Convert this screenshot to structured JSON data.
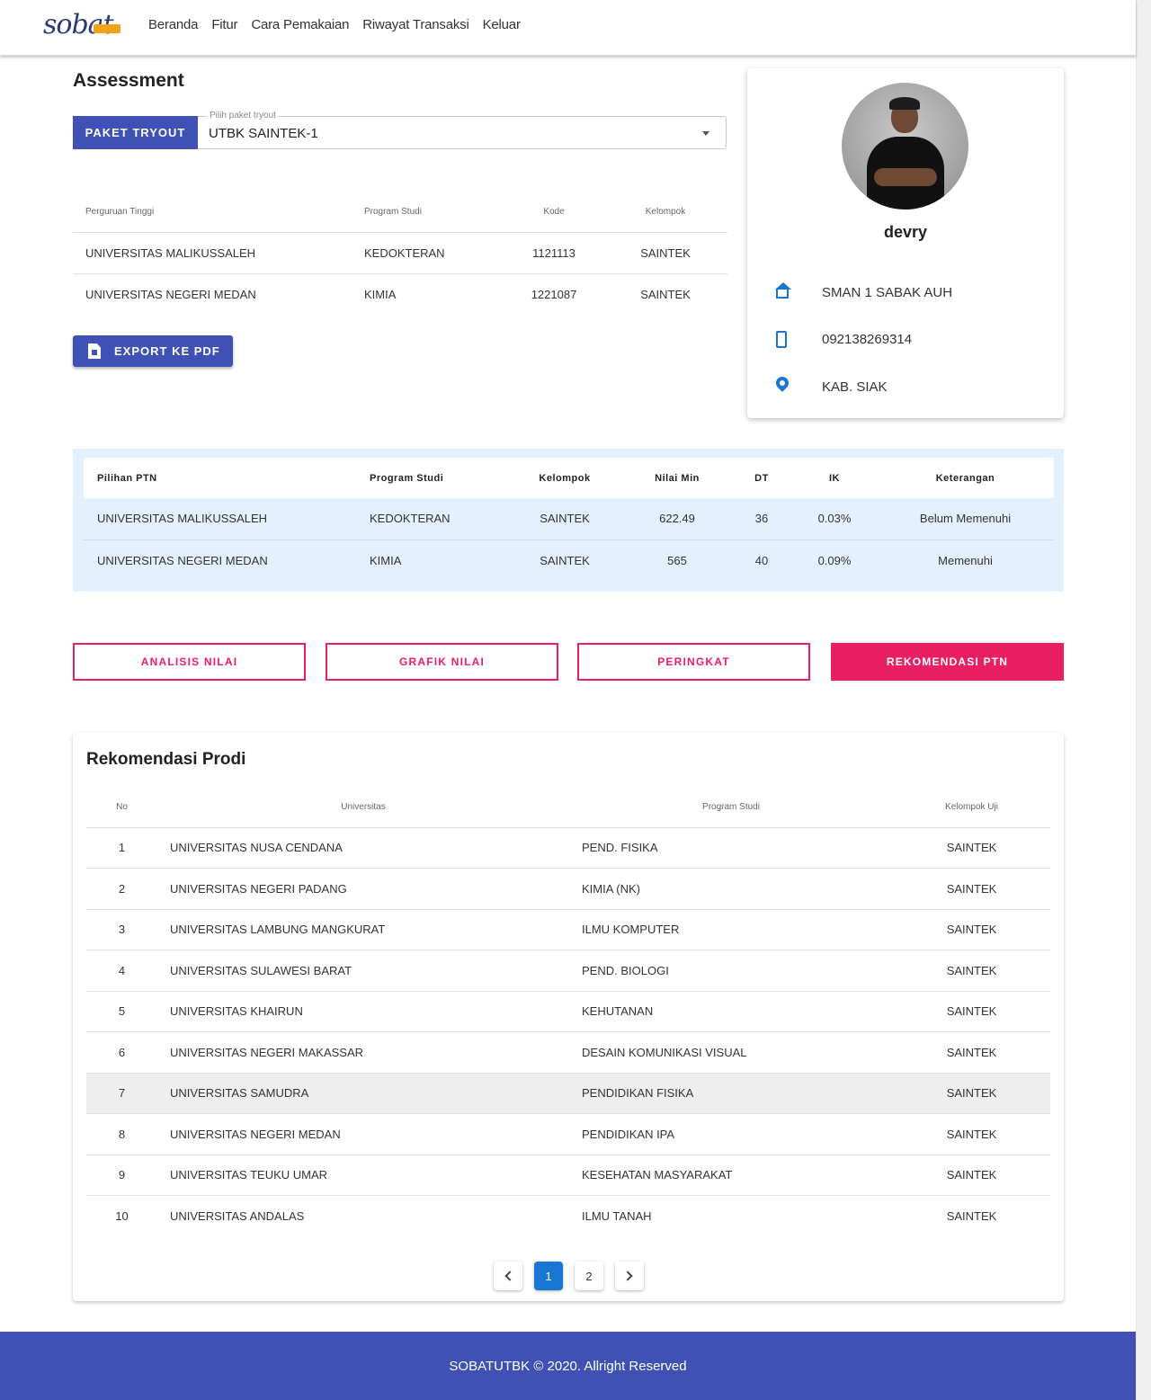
{
  "header": {
    "logo_text": "sobat",
    "nav": [
      "Beranda",
      "Fitur",
      "Cara Pemakaian",
      "Riwayat Transaksi",
      "Keluar"
    ]
  },
  "assessment": {
    "title": "Assessment",
    "paket_button": "PAKET TRYOUT",
    "select_label": "Pilih paket tryout",
    "select_value": "UTBK SAINTEK-1",
    "choices_table": {
      "headers": [
        "Perguruan Tinggi",
        "Program Studi",
        "Kode",
        "Kelompok"
      ],
      "rows": [
        [
          "UNIVERSITAS MALIKUSSALEH",
          "KEDOKTERAN",
          "1121113",
          "SAINTEK"
        ],
        [
          "UNIVERSITAS NEGERI MEDAN",
          "KIMIA",
          "1221087",
          "SAINTEK"
        ]
      ]
    },
    "export_button": "EXPORT KE PDF"
  },
  "profile": {
    "name": "devry",
    "school": "SMAN 1 SABAK AUH",
    "phone": "092138269314",
    "location": "KAB. SIAK",
    "icons": [
      "school-icon",
      "phone-icon",
      "location-pin-icon"
    ]
  },
  "ptn": {
    "headers": [
      "Pilihan PTN",
      "Program Studi",
      "Kelompok",
      "Nilai Min",
      "DT",
      "IK",
      "Keterangan"
    ],
    "rows": [
      [
        "UNIVERSITAS MALIKUSSALEH",
        "KEDOKTERAN",
        "SAINTEK",
        "622.49",
        "36",
        "0.03%",
        "Belum Memenuhi"
      ],
      [
        "UNIVERSITAS NEGERI MEDAN",
        "KIMIA",
        "SAINTEK",
        "565",
        "40",
        "0.09%",
        "Memenuhi"
      ]
    ]
  },
  "tabs": [
    "ANALISIS NILAI",
    "GRAFIK NILAI",
    "PERINGKAT",
    "REKOMENDASI PTN"
  ],
  "rekomendasi": {
    "title": "Rekomendasi Prodi",
    "headers": [
      "No",
      "Universitas",
      "Program Studi",
      "Kelompok Uji"
    ],
    "rows": [
      [
        "1",
        "UNIVERSITAS NUSA CENDANA",
        "PEND. FISIKA",
        "SAINTEK"
      ],
      [
        "2",
        "UNIVERSITAS NEGERI PADANG",
        "KIMIA (NK)",
        "SAINTEK"
      ],
      [
        "3",
        "UNIVERSITAS LAMBUNG MANGKURAT",
        "ILMU KOMPUTER",
        "SAINTEK"
      ],
      [
        "4",
        "UNIVERSITAS SULAWESI BARAT",
        "PEND. BIOLOGI",
        "SAINTEK"
      ],
      [
        "5",
        "UNIVERSITAS KHAIRUN",
        "KEHUTANAN",
        "SAINTEK"
      ],
      [
        "6",
        "UNIVERSITAS NEGERI MAKASSAR",
        "DESAIN KOMUNIKASI VISUAL",
        "SAINTEK"
      ],
      [
        "7",
        "UNIVERSITAS SAMUDRA",
        "PENDIDIKAN FISIKA",
        "SAINTEK"
      ],
      [
        "8",
        "UNIVERSITAS NEGERI MEDAN",
        "PENDIDIKAN IPA",
        "SAINTEK"
      ],
      [
        "9",
        "UNIVERSITAS TEUKU UMAR",
        "KESEHATAN MASYARAKAT",
        "SAINTEK"
      ],
      [
        "10",
        "UNIVERSITAS ANDALAS",
        "ILMU TANAH",
        "SAINTEK"
      ]
    ],
    "pages": [
      "1",
      "2"
    ],
    "current_page": "1"
  },
  "footer": {
    "text": "SOBATUTBK © 2020. Allright Reserved"
  },
  "colors": {
    "primary": "#3f51b5",
    "accent": "#e91e63",
    "panel": "#e3f0fd",
    "icon_blue": "#1976d2"
  }
}
